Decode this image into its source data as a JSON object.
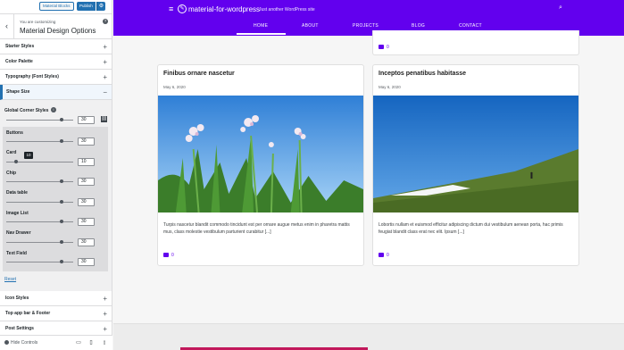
{
  "topbar": {
    "material_blocks_label": "Material Blocks",
    "publish_label": "Publish",
    "settings_glyph": "⚙"
  },
  "panel_header": {
    "back_glyph": "‹",
    "customizing_label": "You are customizing",
    "title": "Material Design Options",
    "help_glyph": "?"
  },
  "sections_before": [
    {
      "label": "Starter Styles"
    },
    {
      "label": "Color Palette"
    },
    {
      "label": "Typography (Font Styles)"
    }
  ],
  "open_section": {
    "label": "Shape Size",
    "collapse_glyph": "−"
  },
  "expand_glyph": "+",
  "shape_size": {
    "global_label": "Global Corner Styles",
    "info_glyph": "i",
    "global_value": "30",
    "global_level": 0.82,
    "link_glyph": "⛓",
    "tooltip": "10",
    "components": [
      {
        "label": "Buttons",
        "value": "30",
        "level": 0.82
      },
      {
        "label": "Card",
        "value": "10",
        "level": 0.15
      },
      {
        "label": "Chip",
        "value": "30",
        "level": 0.82
      },
      {
        "label": "Data table",
        "value": "30",
        "level": 0.82
      },
      {
        "label": "Image List",
        "value": "30",
        "level": 0.82
      },
      {
        "label": "Nav Drawer",
        "value": "30",
        "level": 0.82
      },
      {
        "label": "Text Field",
        "value": "30",
        "level": 0.82
      }
    ],
    "reset_label": "Reset"
  },
  "sections_after": [
    {
      "label": "Icon Styles"
    },
    {
      "label": "Top app bar & Footer"
    },
    {
      "label": "Post Settings"
    }
  ],
  "footer": {
    "hide_controls_label": "Hide Controls",
    "desktop_glyph": "▭",
    "tablet_glyph": "▯",
    "mobile_glyph": "▯"
  },
  "site": {
    "menu_glyph": "≡",
    "logo_glyph": "✎",
    "title": "material-for-wordpress",
    "tagline": "Just another WordPress site",
    "search_glyph": "⌕",
    "nav": [
      "HOME",
      "ABOUT",
      "PROJECTS",
      "BLOG",
      "CONTACT"
    ],
    "brand_color": "#6200ee"
  },
  "top_card": {
    "comments": "0"
  },
  "posts": [
    {
      "title": "Finibus ornare nascetur",
      "date": "May 6, 2020",
      "excerpt": "Turpis nascetur blandit commodo tincidunt est per ornare augue metus enim in pharetra mattis mus, class molestie vestibulum parturient curabitur [...]",
      "comments": "0"
    },
    {
      "title": "Inceptos penatibus habitasse",
      "date": "May 6, 2020",
      "excerpt": "Lobortis nullam et euismod efficitur adipiscing dictum dui vestibulum aenean porta, hac primis feugiat blandit class erat nec elit. Ipsum [...]",
      "comments": "0"
    }
  ]
}
